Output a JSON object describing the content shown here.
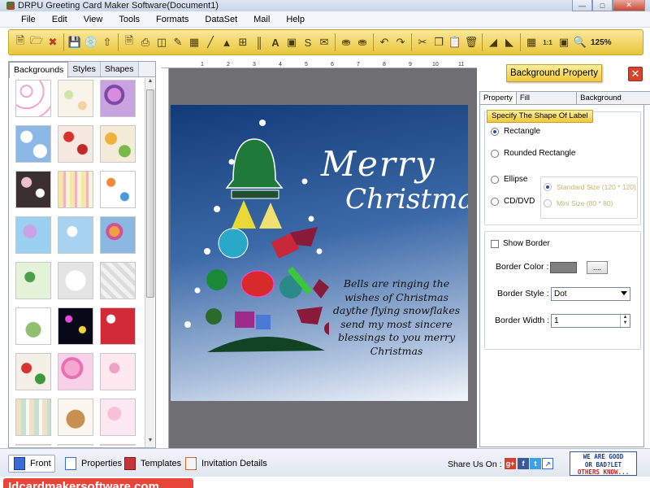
{
  "window": {
    "title": "DRPU Greeting Card Maker Software(Document1)"
  },
  "menu": [
    "File",
    "Edit",
    "View",
    "Tools",
    "Formats",
    "DataSet",
    "Mail",
    "Help"
  ],
  "toolbar": {
    "zoom": "125%"
  },
  "left_panel": {
    "tabs": [
      "Backgrounds",
      "Styles",
      "Shapes"
    ],
    "active_tab": "Backgrounds"
  },
  "card": {
    "title_line1": "Merry",
    "title_line2": "Christmas",
    "message": "Bells are ringing the wishes of Christmas daythe flying snowflakes send my most sincere blessings to you merry Christmas"
  },
  "ruler": {
    "marks": [
      "1",
      "2",
      "3",
      "4",
      "5",
      "6",
      "7",
      "8",
      "9",
      "10",
      "11"
    ]
  },
  "right_panel": {
    "header_button": "Background Property",
    "tabs": [
      "Property",
      "Fill Background",
      "Background Effects"
    ],
    "active_tab": "Property",
    "shape_group_title": "Specify The Shape Of Label",
    "shapes": {
      "rectangle": "Rectangle",
      "rounded": "Rounded Rectangle",
      "ellipse": "Ellipse",
      "cd_dvd": "CD/DVD"
    },
    "sizes": {
      "standard": "Standard Size (120 * 120)",
      "mini": "Mini Size (80 * 80)"
    },
    "show_border": "Show Border",
    "border_color_label": "Border Color :",
    "border_color_value": "#808080",
    "dots_button": "....",
    "border_style_label": "Border Style :",
    "border_style_value": "Dot",
    "border_width_label": "Border Width :",
    "border_width_value": "1"
  },
  "bottom": {
    "tabs": [
      "Front",
      "Properties",
      "Templates",
      "Invitation Details"
    ],
    "share_label": "Share Us On :",
    "feedback_lines": [
      "WE ARE GOOD",
      "OR BAD?LET",
      "OTHERS KNOW..."
    ]
  },
  "footer": {
    "site": "Idcardmakersoftware.com"
  }
}
